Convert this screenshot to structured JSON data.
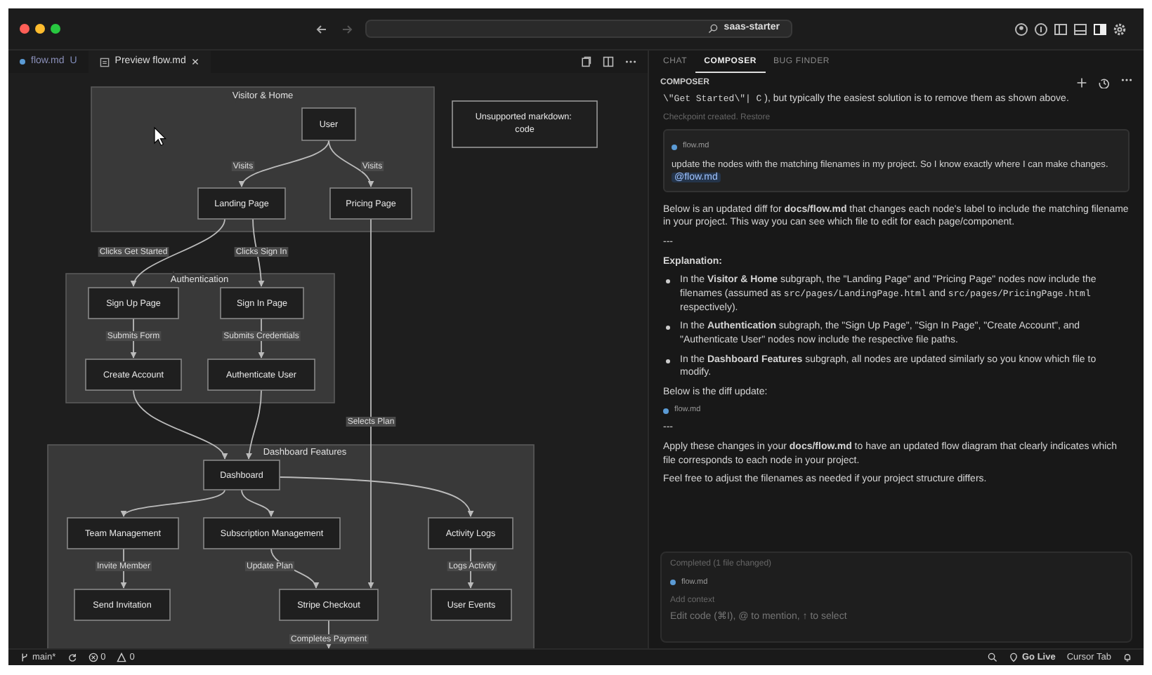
{
  "window": {
    "search": "saas-starter"
  },
  "editor_tabs": [
    {
      "label": "flow.md",
      "badge": "U",
      "selected": false
    },
    {
      "label": "Preview flow.md",
      "closable": true,
      "selected": true
    }
  ],
  "diagram": {
    "subgraphs": [
      "Visitor & Home",
      "Authentication",
      "Dashboard Features"
    ],
    "nodes": [
      "User",
      "Landing Page",
      "Pricing Page",
      "Sign Up Page",
      "Sign In Page",
      "Create Account",
      "Authenticate User",
      "Dashboard",
      "Team Management",
      "Subscription Management",
      "Activity Logs",
      "Send Invitation",
      "Stripe Checkout",
      "User Events"
    ],
    "edge_labels": [
      "Visits",
      "Visits",
      "Clicks Get Started",
      "Clicks Sign In",
      "Submits Form",
      "Submits Credentials",
      "Selects Plan",
      "Invite Member",
      "Update Plan",
      "Logs Activity",
      "Completes Payment"
    ],
    "note": "Unsupported markdown: code"
  },
  "panel_tabs": [
    {
      "label": "CHAT",
      "selected": false
    },
    {
      "label": "COMPOSER",
      "selected": true
    },
    {
      "label": "BUG FINDER",
      "selected": false
    }
  ],
  "composer": {
    "title": "COMPOSER",
    "messages": [
      {
        "kind": "text",
        "segments": [
          {
            "code": true,
            "text": "\\\"Get Started\\\"| C"
          },
          {
            "code": false,
            "text": " ), but typically the easiest solution is to remove them as shown above."
          }
        ]
      },
      {
        "kind": "checkpoint",
        "text": "Checkpoint created. Restore"
      },
      {
        "kind": "user",
        "file": "flow.md",
        "text": "update the nodes with the matching filenames in my project. So I know exactly where I can make changes.",
        "mention": "@flow.md"
      },
      {
        "kind": "text",
        "text": "Below is an updated diff for **docs/flow.md** that changes each node's label to include the matching filename in your project. This way you can see which file to edit for each page/component."
      },
      {
        "kind": "rule",
        "text": "---"
      },
      {
        "kind": "heading",
        "text": "Explanation:"
      },
      {
        "kind": "bullet",
        "segments": [
          {
            "code": false,
            "text": "In the "
          },
          {
            "code": false,
            "bold": true,
            "text": "Visitor & Home"
          },
          {
            "code": false,
            "text": " subgraph, the \"Landing Page\" and \"Pricing Page\" nodes now include the filenames (assumed as "
          },
          {
            "code": true,
            "text": "src/pages/LandingPage.html"
          },
          {
            "code": false,
            "text": " and "
          },
          {
            "code": true,
            "text": "src/pages/PricingPage.html"
          },
          {
            "code": false,
            "text": " respectively)."
          }
        ]
      },
      {
        "kind": "bullet",
        "text": "In the **Authentication** subgraph, the \"Sign Up Page\", \"Sign In Page\", \"Create Account\", and \"Authenticate User\" nodes now include the respective file paths."
      },
      {
        "kind": "bullet",
        "text": "In the **Dashboard Features** subgraph, all nodes are updated similarly so you know which file to modify."
      },
      {
        "kind": "text",
        "text": "Below is the diff update:"
      },
      {
        "kind": "file",
        "text": "flow.md"
      },
      {
        "kind": "rule",
        "text": "---"
      },
      {
        "kind": "text",
        "text": "Apply these changes in your **docs/flow.md** to have an updated flow diagram that clearly indicates which file corresponds to each node in your project."
      },
      {
        "kind": "text",
        "text": "Feel free to adjust the filenames as needed if your project structure differs."
      }
    ],
    "input": {
      "status": "Completed (1 file changed)",
      "file": "flow.md",
      "add_context": "Add context",
      "placeholder": "Edit code (⌘I), @ to mention, ↑ to select"
    }
  },
  "status_bar": {
    "branch": "main*",
    "errors": "0",
    "warnings": "0",
    "go_live": "Go Live",
    "cursor_tab": "Cursor Tab"
  }
}
